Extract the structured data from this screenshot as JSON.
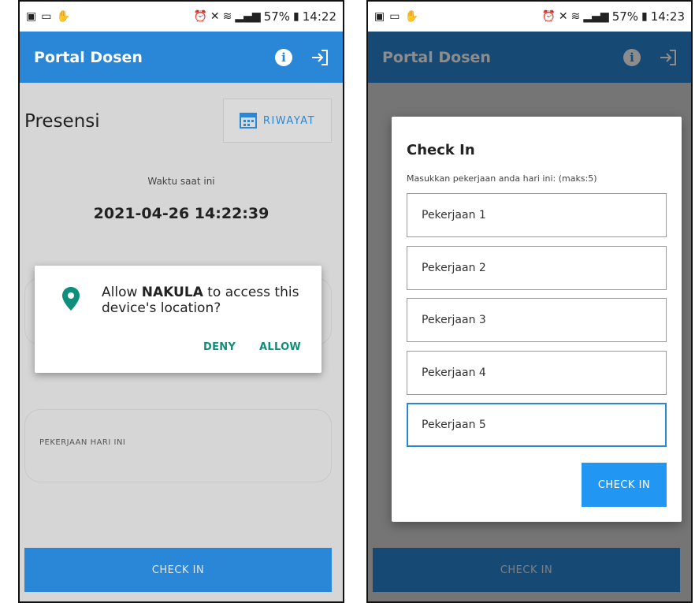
{
  "left_screen": {
    "status_time": "14:22",
    "status_battery": "57%",
    "app_title": "Portal Dosen",
    "page_title": "Presensi",
    "riwayat_label": "RIWAYAT",
    "waktu_label": "Waktu saat ini",
    "waktu_value": "2021-04-26 14:22:39",
    "pekerjaan_label": "PEKERJAAN HARI INI",
    "checkin_label": "CHECK IN",
    "permission_dialog": {
      "prefix": "Allow ",
      "app_name": "NAKULA",
      "suffix": " to access this device's location?",
      "deny_label": "DENY",
      "allow_label": "ALLOW"
    }
  },
  "right_screen": {
    "status_time": "14:23",
    "status_battery": "57%",
    "app_title": "Portal Dosen",
    "checkin_label": "CHECK IN",
    "dialog": {
      "title": "Check In",
      "subtitle": "Masukkan pekerjaan anda hari ini: (maks:5)",
      "inputs": [
        "Pekerjaan 1",
        "Pekerjaan 2",
        "Pekerjaan 3",
        "Pekerjaan 4",
        "Pekerjaan 5"
      ],
      "button_label": "CHECK IN"
    }
  },
  "colors": {
    "appbar": "#2a86d6",
    "pin": "#0e8f7a",
    "dialog_button": "#2196f3"
  }
}
